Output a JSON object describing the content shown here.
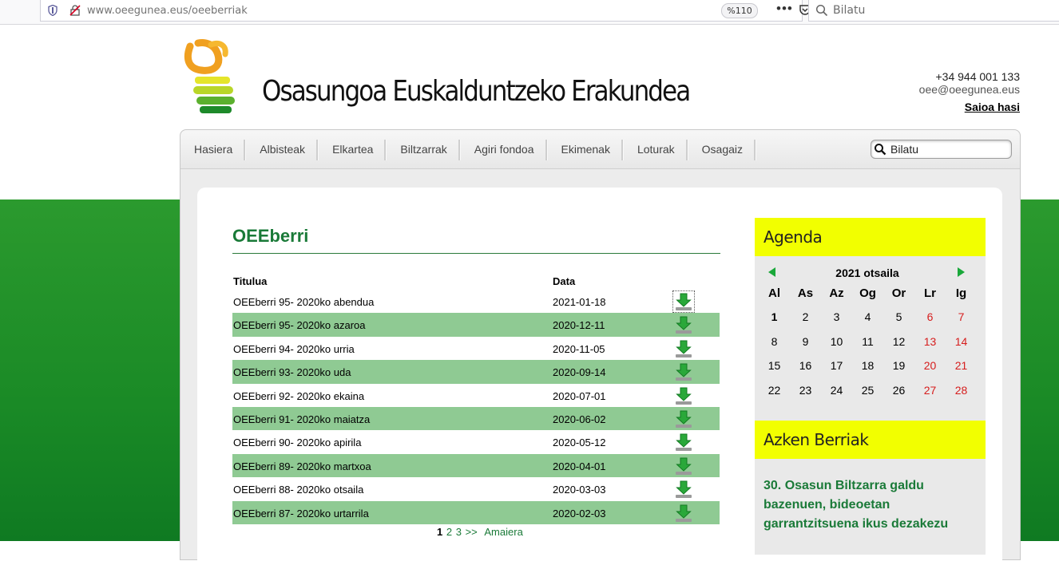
{
  "browser": {
    "url_domain": "www.oeegunea.eus",
    "url_path": "/oeeberriak",
    "zoom": "%110",
    "search_placeholder": "Bilatu"
  },
  "header": {
    "title": "Osasungoa Euskalduntzeko Erakundea",
    "phone": "+34 944 001 133",
    "email": "oee@oeegunea.eus",
    "login": "Saioa hasi"
  },
  "nav": {
    "items": [
      "Hasiera",
      "Albisteak",
      "Elkartea",
      "Biltzarrak",
      "Agiri fondoa",
      "Ekimenak",
      "Loturak",
      "Osagaiz"
    ],
    "search_placeholder": "Bilatu"
  },
  "main": {
    "heading": "OEEberri",
    "columns": [
      "Titulua",
      "Data"
    ],
    "rows": [
      {
        "title": "OEEberri 95- 2020ko abendua",
        "date": "2021-01-18"
      },
      {
        "title": "OEEberri 95- 2020ko azaroa",
        "date": "2020-12-11"
      },
      {
        "title": "OEEberri 94- 2020ko urria",
        "date": "2020-11-05"
      },
      {
        "title": "OEEberri 93- 2020ko uda",
        "date": "2020-09-14"
      },
      {
        "title": "OEEberri 92- 2020ko ekaina",
        "date": "2020-07-01"
      },
      {
        "title": "OEEberri 91- 2020ko maiatza",
        "date": "2020-06-02"
      },
      {
        "title": "OEEberri 90- 2020ko apirila",
        "date": "2020-05-12"
      },
      {
        "title": "OEEberri 89- 2020ko martxoa",
        "date": "2020-04-01"
      },
      {
        "title": "OEEberri 88- 2020ko otsaila",
        "date": "2020-03-03"
      },
      {
        "title": "OEEberri 87- 2020ko urtarrila",
        "date": "2020-02-03"
      }
    ],
    "pager": {
      "current": "1",
      "pages": [
        "2",
        "3"
      ],
      "next": ">>",
      "last": "Amaiera"
    }
  },
  "sidebar": {
    "agenda": {
      "title": "Agenda",
      "month": "2021 otsaila",
      "weekdays": [
        "Al",
        "As",
        "Az",
        "Og",
        "Or",
        "Lr",
        "Ig"
      ],
      "weeks": [
        [
          "1",
          "2",
          "3",
          "4",
          "5",
          "6",
          "7"
        ],
        [
          "8",
          "9",
          "10",
          "11",
          "12",
          "13",
          "14"
        ],
        [
          "15",
          "16",
          "17",
          "18",
          "19",
          "20",
          "21"
        ],
        [
          "22",
          "23",
          "24",
          "25",
          "26",
          "27",
          "28"
        ]
      ],
      "weekend_color": "#d61d1d"
    },
    "news": {
      "title": "Azken Berriak",
      "headline": "30. Osasun Biltzarra galdu bazenuen, bideoetan garrantzitsuena ikus dezakezu"
    }
  },
  "colors": {
    "accent_green": "#1a7a38",
    "row_green": "#8fca93",
    "sidebar_yellow": "#f2ff00",
    "band_green": "#2b9a2e"
  }
}
